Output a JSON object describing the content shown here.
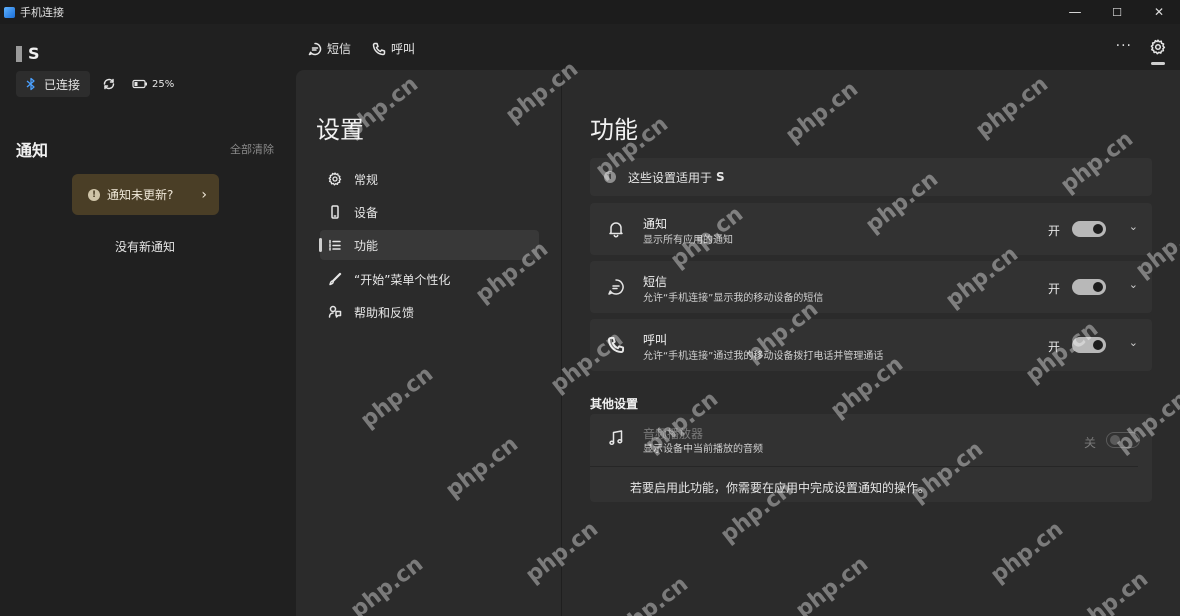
{
  "window": {
    "title": "手机连接",
    "minimize": "—",
    "maximize": "☐",
    "close": "✕"
  },
  "device": {
    "name": "S",
    "status": "已连接",
    "battery": "25%"
  },
  "notifications": {
    "title": "通知",
    "clear_all": "全部清除",
    "update_prompt": "通知未更新?",
    "empty": "没有新通知"
  },
  "tabs": {
    "sms": "短信",
    "calls": "呼叫",
    "more": "···"
  },
  "settings": {
    "title": "设置",
    "nav": [
      {
        "label": "常规",
        "icon": "gear-icon"
      },
      {
        "label": "设备",
        "icon": "phone-icon"
      },
      {
        "label": "功能",
        "icon": "list-icon"
      },
      {
        "label": "“开始”菜单个性化",
        "icon": "brush-icon"
      },
      {
        "label": "帮助和反馈",
        "icon": "help-icon"
      }
    ]
  },
  "features": {
    "title": "功能",
    "applies_to_prefix": "这些设置适用于",
    "applies_to_device": "S",
    "items": [
      {
        "name": "通知",
        "desc": "显示所有应用的通知",
        "state": "开",
        "icon": "bell-icon"
      },
      {
        "name": "短信",
        "desc": "允许“手机连接”显示我的移动设备的短信",
        "state": "开",
        "icon": "chat-icon"
      },
      {
        "name": "呼叫",
        "desc": "允许“手机连接”通过我的移动设备拨打电话并管理通话",
        "state": "开",
        "icon": "phone-call-icon"
      }
    ],
    "chevron": "⌄"
  },
  "other": {
    "title": "其他设置",
    "audio_name": "音频播放器",
    "audio_desc": "显示设备中当前播放的音频",
    "audio_state": "关",
    "hint": "若要启用此功能，你需要在应用中完成设置通知的操作。"
  },
  "watermark": "php.cn"
}
